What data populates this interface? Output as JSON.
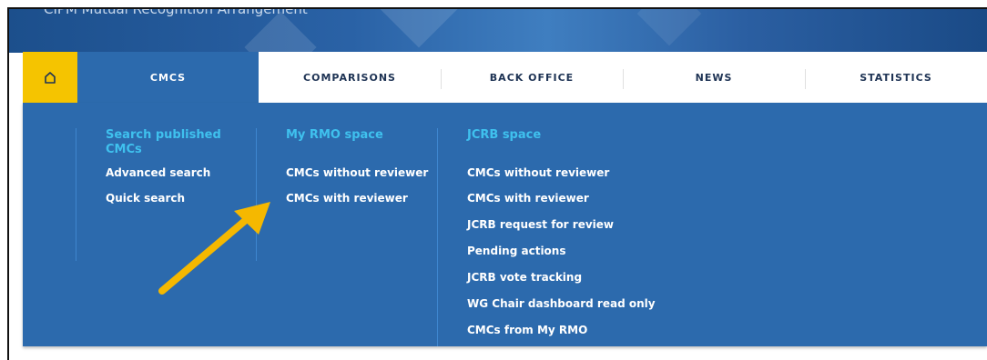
{
  "banner": {
    "text": "CIPM Mutual Recognition Arrangement"
  },
  "nav": {
    "home_icon": "home-icon",
    "tabs": [
      "CMCS",
      "COMPARISONS",
      "BACK OFFICE",
      "NEWS",
      "STATISTICS"
    ],
    "active_tab": "CMCS"
  },
  "dropdown": {
    "search": {
      "heading": "Search published CMCs",
      "items": [
        "Advanced search",
        "Quick search"
      ]
    },
    "rmo": {
      "heading": "My RMO space",
      "items": [
        "CMCs without reviewer",
        "CMCs with reviewer"
      ]
    },
    "jcrb": {
      "heading": "JCRB space",
      "items": [
        "CMCs without reviewer",
        "CMCs with reviewer",
        "JCRB request for review",
        "Pending actions",
        "JCRB vote tracking",
        "WG Chair dashboard read only",
        "CMCs from My RMO"
      ]
    }
  },
  "colors": {
    "home_bg": "#f5c400",
    "menu_bg": "#2c6aad",
    "heading": "#3fc1ee",
    "arrow": "#f5b800"
  }
}
